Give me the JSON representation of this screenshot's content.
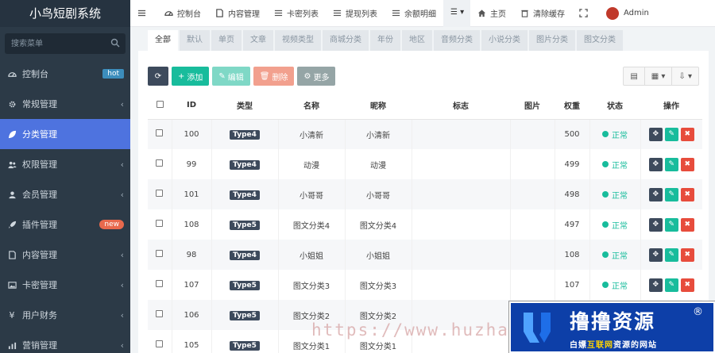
{
  "app": {
    "title": "小鸟短剧系统"
  },
  "sidebar": {
    "search_placeholder": "搜索菜单",
    "items": [
      {
        "label": "控制台",
        "icon": "dashboard-icon",
        "badge": "hot",
        "badge_type": "hot",
        "active": false,
        "has_children": false
      },
      {
        "label": "常规管理",
        "icon": "cogs-icon",
        "active": false,
        "has_children": true
      },
      {
        "label": "分类管理",
        "icon": "leaf-icon",
        "active": true,
        "has_children": false
      },
      {
        "label": "权限管理",
        "icon": "group-icon",
        "active": false,
        "has_children": true
      },
      {
        "label": "会员管理",
        "icon": "user-icon",
        "active": false,
        "has_children": true
      },
      {
        "label": "插件管理",
        "icon": "rocket-icon",
        "badge": "new",
        "badge_type": "new",
        "active": false,
        "has_children": false
      },
      {
        "label": "内容管理",
        "icon": "file-icon",
        "active": false,
        "has_children": true
      },
      {
        "label": "卡密管理",
        "icon": "image-icon",
        "active": false,
        "has_children": true
      },
      {
        "label": "用户财务",
        "icon": "yen-icon",
        "active": false,
        "has_children": true
      },
      {
        "label": "营销管理",
        "icon": "chart-icon",
        "active": false,
        "has_children": true
      }
    ]
  },
  "topnav": {
    "items": [
      {
        "label": "",
        "icon": "menu-toggle-icon"
      },
      {
        "label": "控制台",
        "icon": "dashboard-icon"
      },
      {
        "label": "内容管理",
        "icon": "file-icon"
      },
      {
        "label": "卡密列表",
        "icon": "list-icon"
      },
      {
        "label": "提现列表",
        "icon": "list-icon"
      },
      {
        "label": "余额明细",
        "icon": "list-icon"
      },
      {
        "label": "",
        "icon": "tabs-dropdown-icon",
        "dark": true
      },
      {
        "label": "主页",
        "icon": "home-icon"
      },
      {
        "label": "清除缓存",
        "icon": "trash-icon"
      },
      {
        "label": "",
        "icon": "fullscreen-icon"
      },
      {
        "label": "Admin",
        "icon": "avatar",
        "avatar": true
      }
    ]
  },
  "subtabs": [
    "全部",
    "默认",
    "单页",
    "文章",
    "视频类型",
    "商城分类",
    "年份",
    "地区",
    "音频分类",
    "小说分类",
    "图片分类",
    "图文分类"
  ],
  "toolbar": {
    "add": "添加",
    "edit": "编辑",
    "delete": "删除",
    "more": "更多"
  },
  "table": {
    "columns": [
      "",
      "ID",
      "类型",
      "名称",
      "昵称",
      "标志",
      "图片",
      "权重",
      "状态",
      "操作"
    ],
    "rows": [
      {
        "id": "100",
        "type": "Type4",
        "name": "小清新",
        "nickname": "小清新",
        "weigh": "500",
        "status": "正常"
      },
      {
        "id": "99",
        "type": "Type4",
        "name": "动漫",
        "nickname": "动漫",
        "weigh": "499",
        "status": "正常"
      },
      {
        "id": "101",
        "type": "Type4",
        "name": "小哥哥",
        "nickname": "小哥哥",
        "weigh": "498",
        "status": "正常"
      },
      {
        "id": "108",
        "type": "Type5",
        "name": "图文分类4",
        "nickname": "图文分类4",
        "weigh": "497",
        "status": "正常"
      },
      {
        "id": "98",
        "type": "Type4",
        "name": "小姐姐",
        "nickname": "小姐姐",
        "weigh": "108",
        "status": "正常"
      },
      {
        "id": "107",
        "type": "Type5",
        "name": "图文分类3",
        "nickname": "图文分类3",
        "weigh": "107",
        "status": "正常"
      },
      {
        "id": "106",
        "type": "Type5",
        "name": "图文分类2",
        "nickname": "图文分类2",
        "weigh": "",
        "status": ""
      },
      {
        "id": "105",
        "type": "Type5",
        "name": "图文分类1",
        "nickname": "图文分类1",
        "weigh": "",
        "status": ""
      }
    ]
  },
  "watermark": {
    "url_text": "https://www.huzhar",
    "title": "撸撸资源",
    "reg": "®",
    "sub_prefix": "白嫖",
    "sub_highlight": "互联网",
    "sub_suffix": "资源的网站"
  }
}
